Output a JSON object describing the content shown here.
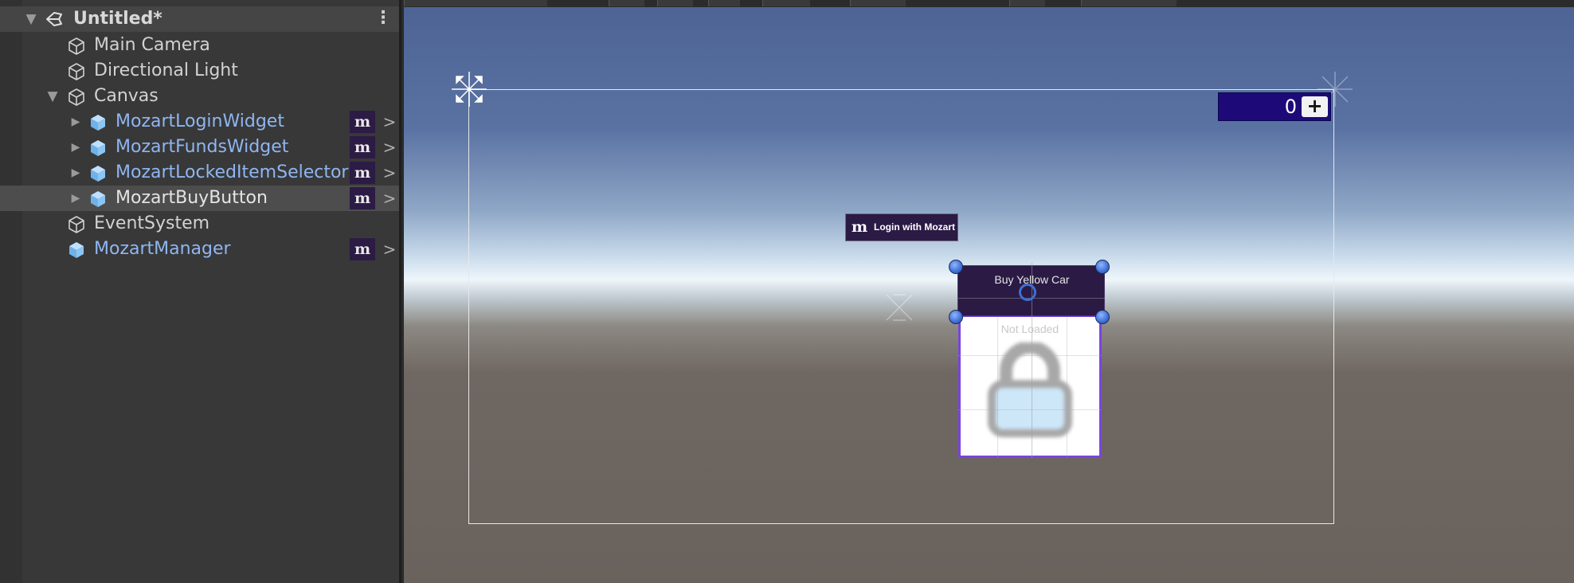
{
  "hierarchy": {
    "scene_name": "Untitled*",
    "items": [
      {
        "label": "Main Camera"
      },
      {
        "label": "Directional Light"
      },
      {
        "label": "Canvas"
      },
      {
        "label": "MozartLoginWidget"
      },
      {
        "label": "MozartFundsWidget"
      },
      {
        "label": "MozartLockedItemSelector"
      },
      {
        "label": "MozartBuyButton"
      },
      {
        "label": "EventSystem"
      },
      {
        "label": "MozartManager"
      }
    ],
    "badge_glyph": "m",
    "chevron_glyph": ">",
    "expand_glyph": "▶",
    "collapse_glyph": "▼",
    "menu_glyph": "⋮"
  },
  "scene": {
    "funds_value": "0",
    "funds_add_label": "+",
    "login_brand_glyph": "m",
    "login_label": "Login with Mozart",
    "buy_label": "Buy Yellow Car",
    "locked_status": "Not Loaded"
  },
  "colors": {
    "prefab_text": "#8fb6f2",
    "mozart_purple": "#2a1a44",
    "funds_blue": "#1d0a78",
    "selection_border": "#7a44e0",
    "handle_blue": "#3f6fd6"
  }
}
